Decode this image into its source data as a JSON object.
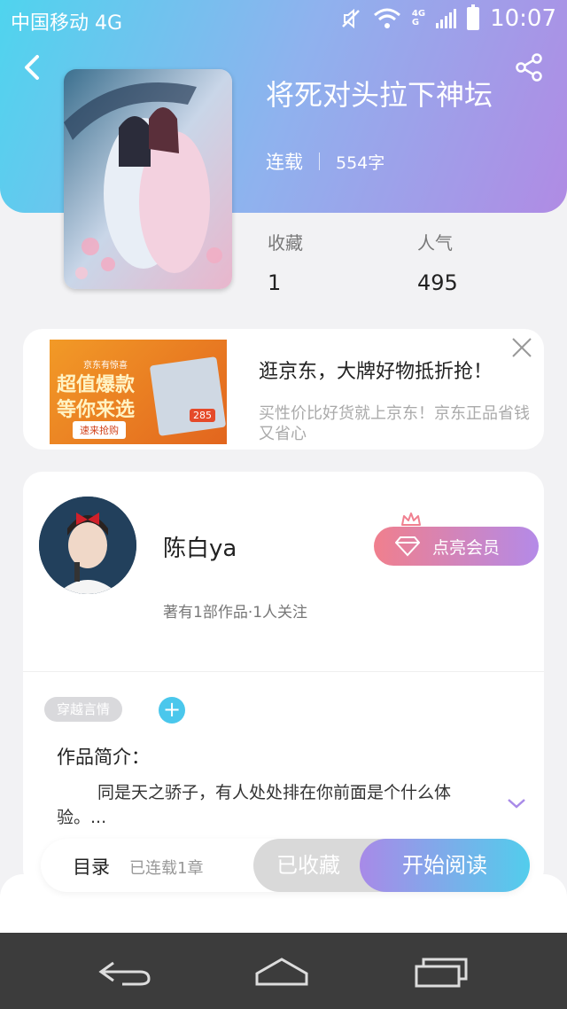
{
  "status_bar": {
    "carrier": "中国移动 4G",
    "network_top": "4G",
    "network_bottom": "G",
    "time": "10:07"
  },
  "book": {
    "title": "将死对头拉下神坛",
    "status": "连载",
    "word_count": "554字"
  },
  "stats": {
    "favorites_label": "收藏",
    "favorites_value": "1",
    "popularity_label": "人气",
    "popularity_value": "495"
  },
  "ad": {
    "title": "逛京东，大牌好物抵折抢！",
    "description": "买性价比好货就上京东！京东正品省钱又省心",
    "image_slogan_line1": "超值爆款",
    "image_slogan_line2": "等你来选",
    "image_cta": "速来抢购",
    "image_label": "京东有惊喜",
    "image_price": "285"
  },
  "author": {
    "name": "陈白ya",
    "stats": "著有1部作品·1人关注",
    "vip_button": "点亮会员"
  },
  "tags": [
    "穿越言情"
  ],
  "intro": {
    "label": "作品简介：",
    "text": "同是天之骄子，有人处处排在你前面是个什么体验。..."
  },
  "bottom_bar": {
    "toc": "目录",
    "chapters": "已连载1章",
    "collected": "已收藏",
    "read": "开始阅读"
  },
  "colors": {
    "hero_start": "#4fd4ee",
    "hero_end": "#b08be4",
    "vip_start": "#f07f8d",
    "vip_end": "#b48ae8"
  }
}
